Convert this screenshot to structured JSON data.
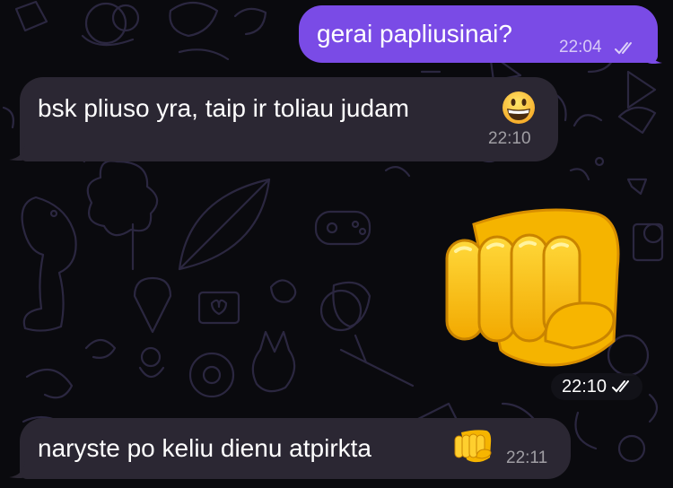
{
  "messages": [
    {
      "direction": "outgoing",
      "text": "gerai papliusinai?",
      "time": "22:04",
      "status": "read"
    },
    {
      "direction": "incoming",
      "text": "bsk pliuso yra, taip ir toliau judam",
      "emoji": "grinning-face",
      "time": "22:10"
    },
    {
      "direction": "outgoing",
      "sticker": "oncoming-fist",
      "time": "22:10",
      "status": "read"
    },
    {
      "direction": "incoming",
      "text": "naryste po keliu dienu atpirkta",
      "emoji": "oncoming-fist",
      "time": "22:11"
    }
  ],
  "colors": {
    "background": "#0a0a0e",
    "outgoing_bubble": "#7a4be6",
    "incoming_bubble": "#2b2733",
    "doodle": "#2b2740"
  }
}
